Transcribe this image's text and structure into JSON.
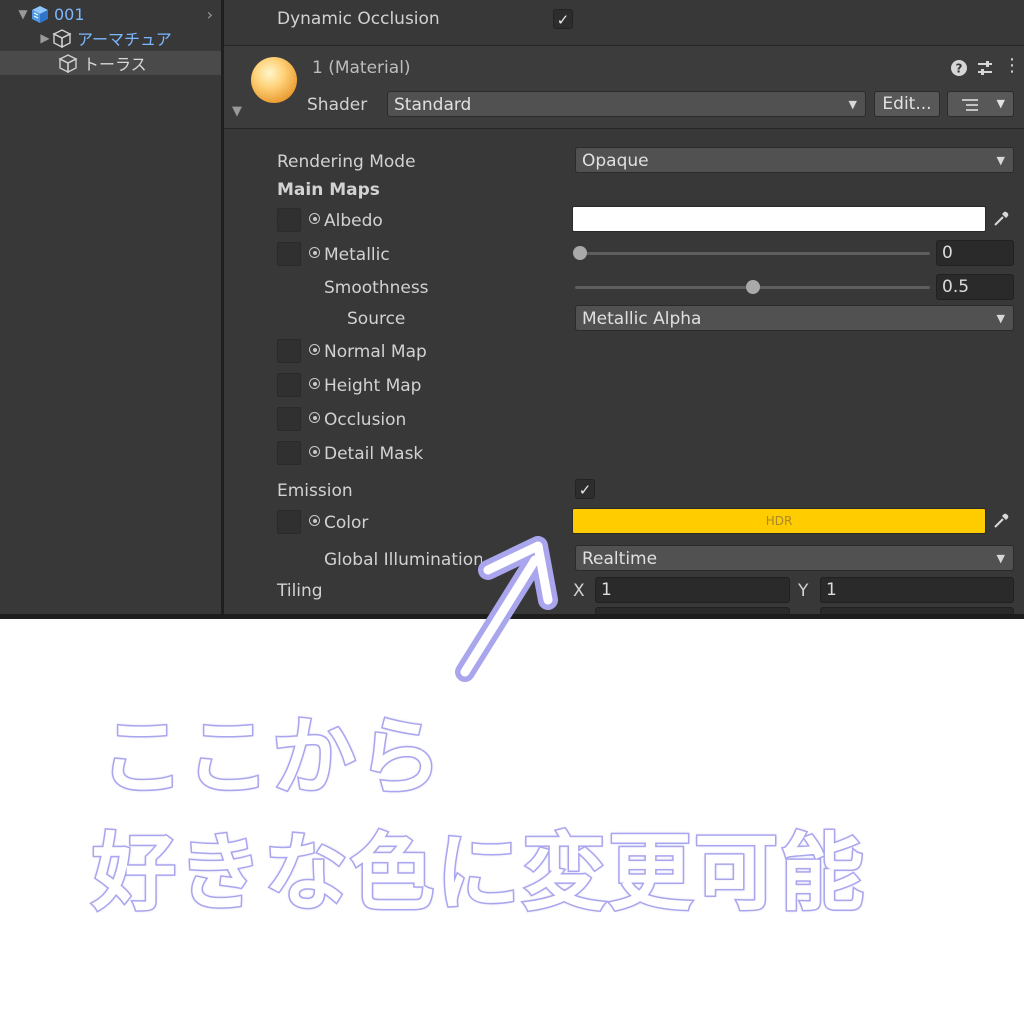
{
  "hierarchy": {
    "items": [
      {
        "label": "001"
      },
      {
        "label": "アーマチュア"
      },
      {
        "label": "トーラス"
      }
    ]
  },
  "inspector": {
    "dynamic_occlusion": {
      "label": "Dynamic Occlusion",
      "checked": true
    },
    "material": {
      "title": "1 (Material)",
      "shader_label": "Shader",
      "shader_value": "Standard",
      "edit_button": "Edit..."
    },
    "rendering_mode": {
      "label": "Rendering Mode",
      "value": "Opaque"
    },
    "main_maps": {
      "label": "Main Maps"
    },
    "albedo": {
      "label": "Albedo",
      "color": "#ffffff"
    },
    "metallic": {
      "label": "Metallic",
      "value": "0",
      "fraction": 0.0
    },
    "smoothness": {
      "label": "Smoothness",
      "value": "0.5",
      "fraction": 0.5
    },
    "source": {
      "label": "Source",
      "value": "Metallic Alpha"
    },
    "normal_map": {
      "label": "Normal Map"
    },
    "height_map": {
      "label": "Height Map"
    },
    "occlusion": {
      "label": "Occlusion"
    },
    "detail_mask": {
      "label": "Detail Mask"
    },
    "emission": {
      "label": "Emission",
      "checked": true
    },
    "emission_color": {
      "label": "Color",
      "badge": "HDR",
      "color": "#ffcc00"
    },
    "global_illumination": {
      "label": "Global Illumination",
      "value": "Realtime"
    },
    "tiling": {
      "label": "Tiling",
      "x_label": "X",
      "x_value": "1",
      "y_label": "Y",
      "y_value": "1"
    }
  },
  "annotation": {
    "line1": "ここから",
    "line2": "好きな色に変更可能",
    "color": "#aaa6ee"
  }
}
